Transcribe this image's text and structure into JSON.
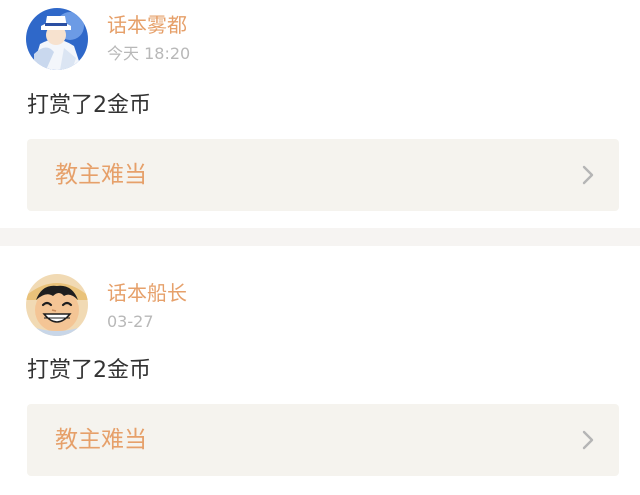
{
  "posts": [
    {
      "username": "话本雾都",
      "timestamp": "今天 18:20",
      "message": "打赏了2金币",
      "link_title": "教主难当"
    },
    {
      "username": "话本船长",
      "timestamp": "03-27",
      "message": "打赏了2金币",
      "link_title": "教主难当"
    }
  ],
  "icons": {
    "chevron": "chevron-right-icon",
    "avatar_1": "detective-avatar",
    "avatar_2": "straw-hat-avatar"
  },
  "colors": {
    "username": "#e6a06a",
    "timestamp": "#b8b8b8",
    "message": "#333333",
    "link_box_bg": "#f5f3ee",
    "separator": "#f6f4f2"
  }
}
